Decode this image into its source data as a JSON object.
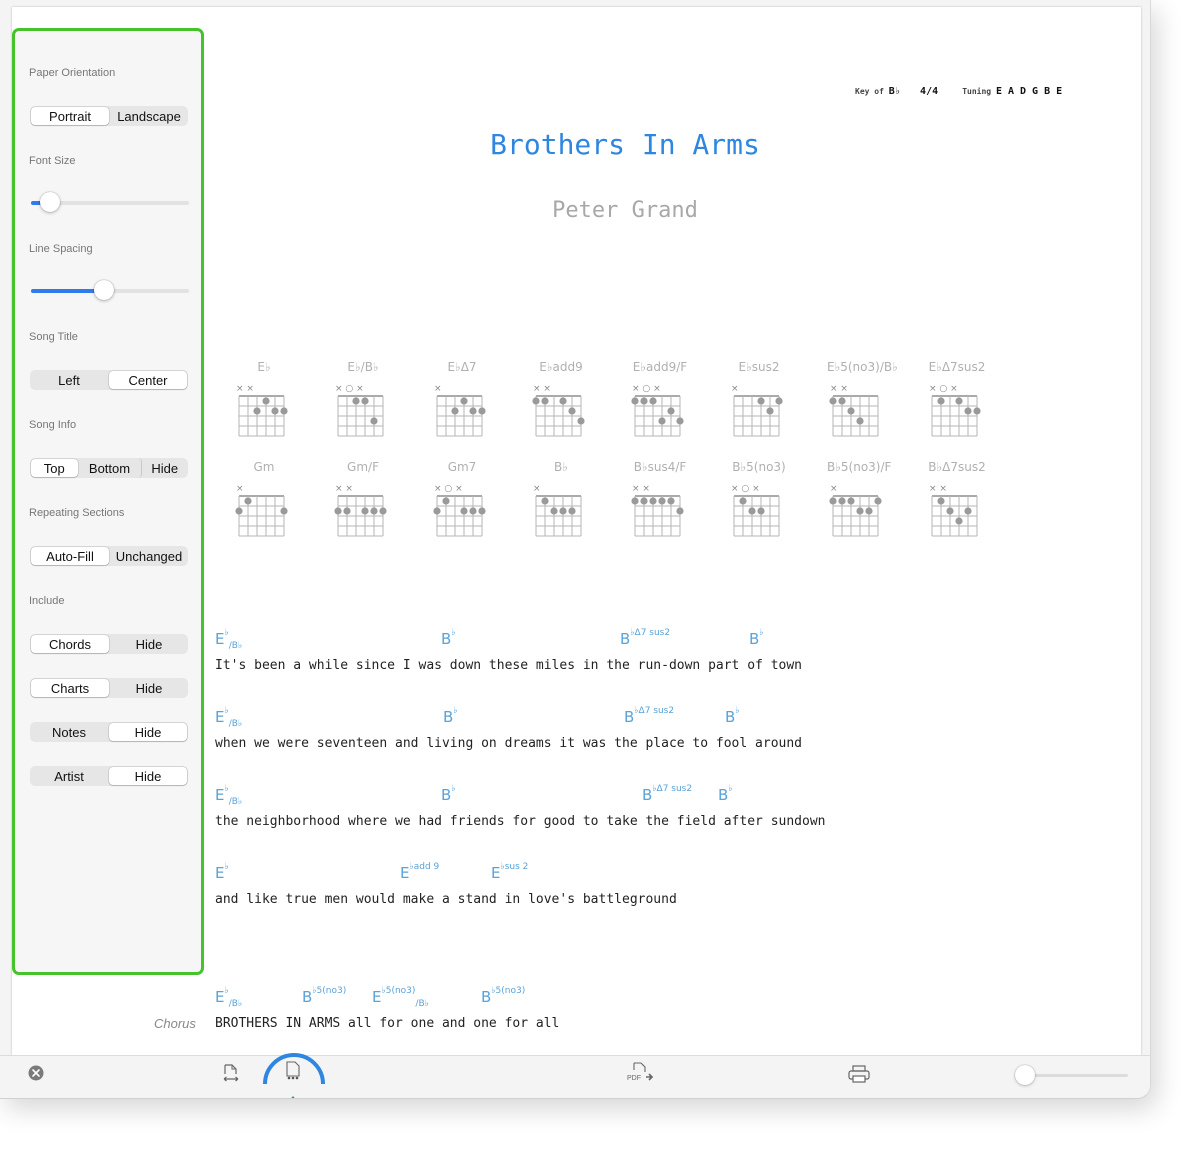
{
  "sidebar": {
    "paper_orientation": {
      "label": "Paper Orientation",
      "options": [
        "Portrait",
        "Landscape"
      ],
      "selected": "Portrait"
    },
    "font_size": {
      "label": "Font Size",
      "value": 0.12
    },
    "line_spacing": {
      "label": "Line Spacing",
      "value": 0.46
    },
    "song_title": {
      "label": "Song Title",
      "options": [
        "Left",
        "Center"
      ],
      "selected": "Center"
    },
    "song_info": {
      "label": "Song Info",
      "options": [
        "Top",
        "Bottom",
        "Hide"
      ],
      "selected": "Top"
    },
    "repeating_sections": {
      "label": "Repeating Sections",
      "options": [
        "Auto-Fill",
        "Unchanged"
      ],
      "selected": "Auto-Fill"
    },
    "include": {
      "label": "Include",
      "chords": {
        "options": [
          "Chords",
          "Hide"
        ],
        "selected": "Chords"
      },
      "charts": {
        "options": [
          "Charts",
          "Hide"
        ],
        "selected": "Charts"
      },
      "notes": {
        "options": [
          "Notes",
          "Hide"
        ],
        "selected": "Hide"
      },
      "artist": {
        "options": [
          "Artist",
          "Hide"
        ],
        "selected": "Hide"
      }
    }
  },
  "song": {
    "key_label": "Key of",
    "key": "B♭",
    "time_signature": "4/4",
    "tuning_label": "Tuning",
    "tuning": "E A D G B E",
    "title": "Brothers In Arms",
    "artist": "Peter Grand"
  },
  "chart_names": {
    "row1": [
      "E♭",
      "E♭/B♭",
      "E♭Δ7",
      "E♭add9",
      "E♭add9/F",
      "E♭sus2",
      "E♭5(no3)/B♭",
      "E♭Δ7sus2"
    ],
    "row2": [
      "Gm",
      "Gm/F",
      "Gm7",
      "B♭",
      "B♭sus4/F",
      "B♭5(no3)",
      "B♭5(no3)/F",
      "B♭Δ7sus2"
    ]
  },
  "lyrics": {
    "line1": "It's been a while since I was down these miles in the run-down part of town",
    "line2": "when we were seventeen and living on dreams it was the place to fool around",
    "line3": "the neighborhood where we had friends for good to take the field after sundown",
    "line4": "and like true men would make a stand in love's battleground",
    "chorus_label": "Chorus",
    "chorus_line": "BROTHERS IN ARMS all for one and one for all"
  },
  "toolbar": {
    "icons": [
      "close-icon",
      "page-resize-icon",
      "page-options-icon",
      "export-pdf-icon",
      "print-icon"
    ],
    "pdf_label": "PDF",
    "zoom": 0.05
  },
  "colors": {
    "accent": "#2f7bec",
    "highlight_border": "#45c32b",
    "title": "#2f86e0",
    "chord": "#5aa3d8",
    "annotation_arrow": "#2f86e0"
  }
}
